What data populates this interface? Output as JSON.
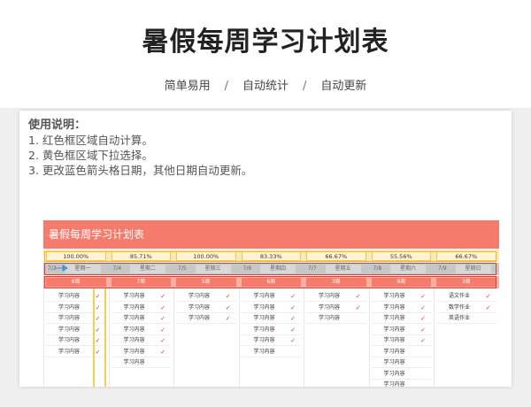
{
  "header": {
    "title": "暑假每周学习计划表",
    "tags": [
      "简单易用",
      "自动统计",
      "自动更新"
    ],
    "separator": "/"
  },
  "instructions": {
    "heading": "使用说明：",
    "items": [
      "1. 红色框区域自动计算。",
      "2. 黄色框区域下拉选择。",
      "3. 更改蓝色箭头格日期，其他日期自动更新。"
    ]
  },
  "sheet": {
    "title": "暑假每周学习计划表",
    "days": [
      {
        "pct": "100.00%",
        "date": "7/2",
        "weekday": "星期一",
        "week": "6周",
        "progress": 1.0,
        "tasks": [
          {
            "text": "学习内容",
            "done": "✓"
          },
          {
            "text": "学习内容",
            "done": "✓"
          },
          {
            "text": "学习内容",
            "done": "✓"
          },
          {
            "text": "学习内容",
            "done": "✓"
          },
          {
            "text": "学习内容",
            "done": "✓"
          },
          {
            "text": "学习内容",
            "done": "✓"
          }
        ]
      },
      {
        "pct": "85.71%",
        "date": "7/4",
        "weekday": "星期二",
        "week": "7周",
        "progress": 0.8571,
        "tasks": [
          {
            "text": "学习内容",
            "done": "✓"
          },
          {
            "text": "学习内容",
            "done": "✓"
          },
          {
            "text": "学习内容",
            "done": "✓"
          },
          {
            "text": "学习内容",
            "done": "✓"
          },
          {
            "text": "学习内容",
            "done": "✓"
          },
          {
            "text": "学习内容",
            "done": "✓"
          },
          {
            "text": "学习内容",
            "done": ""
          }
        ]
      },
      {
        "pct": "100.00%",
        "date": "7/5",
        "weekday": "星期三",
        "week": "5周",
        "progress": 1.0,
        "tasks": [
          {
            "text": "学习内容",
            "done": "✓"
          },
          {
            "text": "学习内容",
            "done": "✓"
          },
          {
            "text": "学习内容",
            "done": "✓"
          }
        ]
      },
      {
        "pct": "83.33%",
        "date": "7/6",
        "weekday": "星期四",
        "week": "6周",
        "progress": 0.8333,
        "tasks": [
          {
            "text": "学习内容",
            "done": "✓"
          },
          {
            "text": "学习内容",
            "done": "✓"
          },
          {
            "text": "学习内容",
            "done": "✓"
          },
          {
            "text": "学习内容",
            "done": "✓"
          },
          {
            "text": "学习内容",
            "done": "✓"
          },
          {
            "text": "学习内容",
            "done": ""
          }
        ]
      },
      {
        "pct": "66.67%",
        "date": "7/7",
        "weekday": "星期五",
        "week": "3周",
        "progress": 0.6667,
        "tasks": [
          {
            "text": "学习内容",
            "done": "✓"
          },
          {
            "text": "学习内容",
            "done": "✓"
          },
          {
            "text": "学习内容",
            "done": ""
          }
        ]
      },
      {
        "pct": "55.56%",
        "date": "7/8",
        "weekday": "星期六",
        "week": "9周",
        "progress": 0.5556,
        "tasks": [
          {
            "text": "学习内容",
            "done": "✓"
          },
          {
            "text": "学习内容",
            "done": "✓"
          },
          {
            "text": "学习内容",
            "done": "✓"
          },
          {
            "text": "学习内容",
            "done": "✓"
          },
          {
            "text": "学习内容",
            "done": "✓"
          },
          {
            "text": "学习内容",
            "done": ""
          },
          {
            "text": "学习内容",
            "done": ""
          },
          {
            "text": "学习内容",
            "done": ""
          },
          {
            "text": "学习内容",
            "done": ""
          }
        ]
      },
      {
        "pct": "66.67%",
        "date": "7/9",
        "weekday": "星期日",
        "week": "3周",
        "progress": 0.6667,
        "tasks": [
          {
            "text": "语文作业",
            "done": "✓"
          },
          {
            "text": "数学作业",
            "done": "✓"
          },
          {
            "text": "英语作业",
            "done": ""
          }
        ]
      }
    ]
  },
  "colors": {
    "banner": "#f57b6c",
    "check": "#e33333",
    "red_box": "#e43a32",
    "yellow_box": "#f0b92b"
  }
}
